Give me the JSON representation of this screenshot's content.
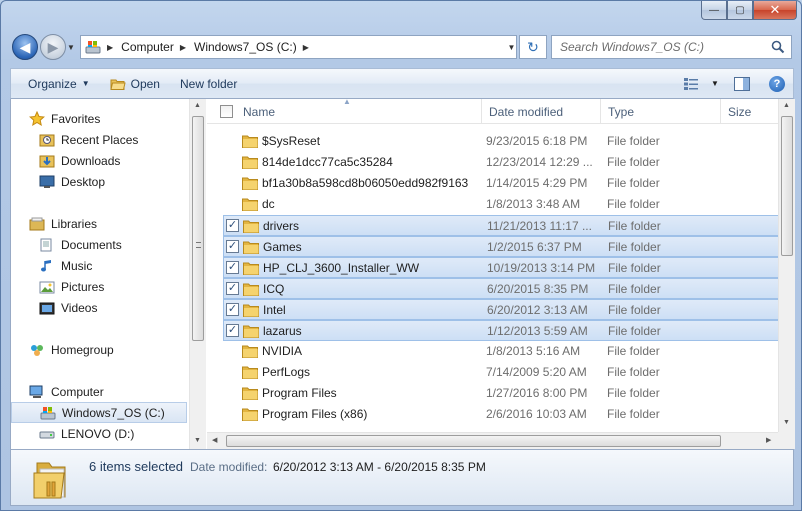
{
  "window": {
    "min_glyph": "—",
    "max_glyph": "▢",
    "close_glyph": "✕"
  },
  "address": {
    "crumbs": [
      "Computer",
      "Windows7_OS (C:)"
    ],
    "search_placeholder": "Search Windows7_OS (C:)"
  },
  "toolbar": {
    "organize": "Organize",
    "open": "Open",
    "new_folder": "New folder"
  },
  "nav": {
    "items": [
      {
        "label": "Favorites",
        "icon": "star-icon"
      },
      {
        "label": "Recent Places",
        "icon": "recent-places-icon"
      },
      {
        "label": "Downloads",
        "icon": "downloads-icon"
      },
      {
        "label": "Desktop",
        "icon": "desktop-icon"
      },
      {
        "label": "Libraries",
        "icon": "libraries-icon"
      },
      {
        "label": "Documents",
        "icon": "documents-icon"
      },
      {
        "label": "Music",
        "icon": "music-icon"
      },
      {
        "label": "Pictures",
        "icon": "pictures-icon"
      },
      {
        "label": "Videos",
        "icon": "videos-icon"
      },
      {
        "label": "Homegroup",
        "icon": "homegroup-icon"
      },
      {
        "label": "Computer",
        "icon": "computer-icon"
      },
      {
        "label": "Windows7_OS (C:)",
        "icon": "drive-c-icon"
      },
      {
        "label": "LENOVO (D:)",
        "icon": "drive-d-icon"
      }
    ]
  },
  "columns": {
    "name": "Name",
    "date": "Date modified",
    "type": "Type",
    "size": "Size"
  },
  "files": [
    {
      "name": "$SysReset",
      "date": "9/23/2015 6:18 PM",
      "type": "File folder",
      "selected": false
    },
    {
      "name": "814de1dcc77ca5c35284",
      "date": "12/23/2014 12:29 ...",
      "type": "File folder",
      "selected": false
    },
    {
      "name": "bf1a30b8a598cd8b06050edd982f9163",
      "date": "1/14/2015 4:29 PM",
      "type": "File folder",
      "selected": false
    },
    {
      "name": "dc",
      "date": "1/8/2013 3:48 AM",
      "type": "File folder",
      "selected": false
    },
    {
      "name": "drivers",
      "date": "11/21/2013 11:17 ...",
      "type": "File folder",
      "selected": true
    },
    {
      "name": "Games",
      "date": "1/2/2015 6:37 PM",
      "type": "File folder",
      "selected": true
    },
    {
      "name": "HP_CLJ_3600_Installer_WW",
      "date": "10/19/2013 3:14 PM",
      "type": "File folder",
      "selected": true
    },
    {
      "name": "ICQ",
      "date": "6/20/2015 8:35 PM",
      "type": "File folder",
      "selected": true
    },
    {
      "name": "Intel",
      "date": "6/20/2012 3:13 AM",
      "type": "File folder",
      "selected": true
    },
    {
      "name": "lazarus",
      "date": "1/12/2013 5:59 AM",
      "type": "File folder",
      "selected": true
    },
    {
      "name": "NVIDIA",
      "date": "1/8/2013 5:16 AM",
      "type": "File folder",
      "selected": false
    },
    {
      "name": "PerfLogs",
      "date": "7/14/2009 5:20 AM",
      "type": "File folder",
      "selected": false
    },
    {
      "name": "Program Files",
      "date": "1/27/2016 8:00 PM",
      "type": "File folder",
      "selected": false
    },
    {
      "name": "Program Files (x86)",
      "date": "2/6/2016 10:03 AM",
      "type": "File folder",
      "selected": false
    }
  ],
  "details": {
    "count": "6 items selected",
    "label": "Date modified:",
    "value": "6/20/2012 3:13 AM - 6/20/2015 8:35 PM"
  },
  "colors": {
    "selection": "#cddff5",
    "folder": "#e8c25a",
    "accent": "#1e395b"
  }
}
